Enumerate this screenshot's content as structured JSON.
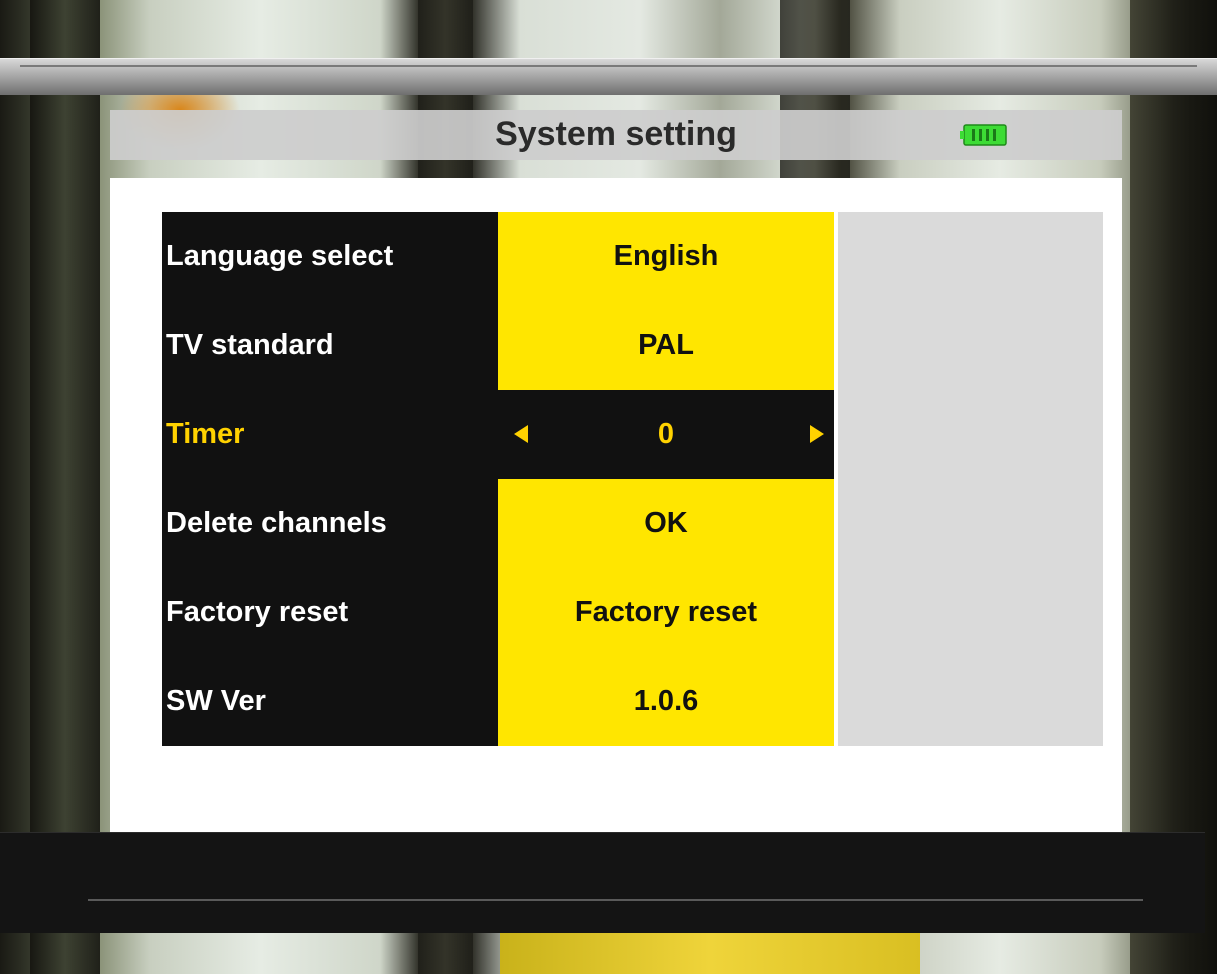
{
  "header": {
    "title": "System setting",
    "battery_icon": "battery-full-icon",
    "battery_color": "#3ddc35"
  },
  "settings": {
    "rows": [
      {
        "label": "Language select",
        "value": "English"
      },
      {
        "label": "TV standard",
        "value": "PAL"
      },
      {
        "label": "Timer",
        "value": "0",
        "selected": true
      },
      {
        "label": "Delete channels",
        "value": "OK"
      },
      {
        "label": "Factory reset",
        "value": "Factory reset"
      },
      {
        "label": "SW Ver",
        "value": "1.0.6"
      }
    ]
  },
  "colors": {
    "value_bg": "#ffe600",
    "label_bg": "#111111",
    "highlight_text": "#ffd200"
  }
}
